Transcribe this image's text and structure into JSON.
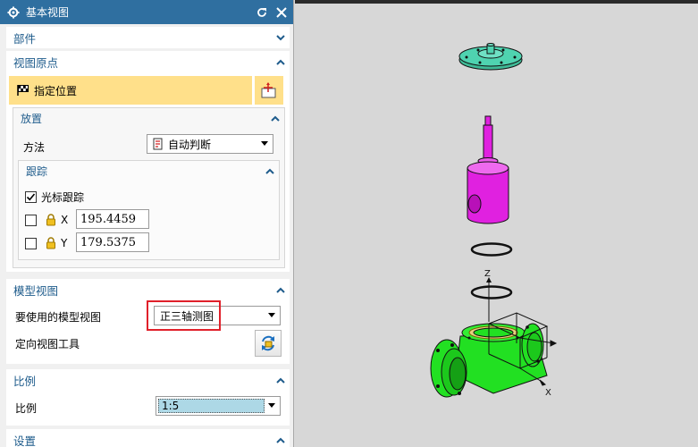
{
  "dialog": {
    "title": "基本视图",
    "icons": {
      "title": "gear-icon",
      "reset": "reset-icon",
      "close": "close-icon"
    }
  },
  "sections": {
    "part": {
      "label": "部件",
      "state": "collapsed"
    },
    "origin": {
      "label": "视图原点",
      "state": "expanded",
      "specify_location": "指定位置",
      "placement": {
        "label": "放置",
        "method_label": "方法",
        "method_value": "自动判断",
        "tracking": {
          "label": "跟踪",
          "cursor_tracking_label": "光标跟踪",
          "cursor_tracking_checked": true,
          "x_label": "X",
          "x_value": "195.4459",
          "x_checked": false,
          "y_label": "Y",
          "y_value": "179.5375",
          "y_checked": false
        }
      }
    },
    "model_view": {
      "label": "模型视图",
      "view_to_use_label": "要使用的模型视图",
      "view_to_use_value": "正三轴测图",
      "orient_tool_label": "定向视图工具"
    },
    "scale": {
      "label": "比例",
      "scale_label": "比例",
      "scale_value": "1:5"
    },
    "settings": {
      "label": "设置"
    }
  },
  "viewport": {
    "axis_labels": {
      "z": "Z",
      "x": "X"
    },
    "colors": {
      "cap": "#4fd3b0",
      "stem": "#e021e0",
      "body": "#22e022",
      "background": "#d7d7d7"
    }
  },
  "colors": {
    "titlebar": "#2f6fa0",
    "section_header": "#1f5c8c",
    "highlight": "#ffe08a",
    "annotation_box": "#e0202a"
  }
}
